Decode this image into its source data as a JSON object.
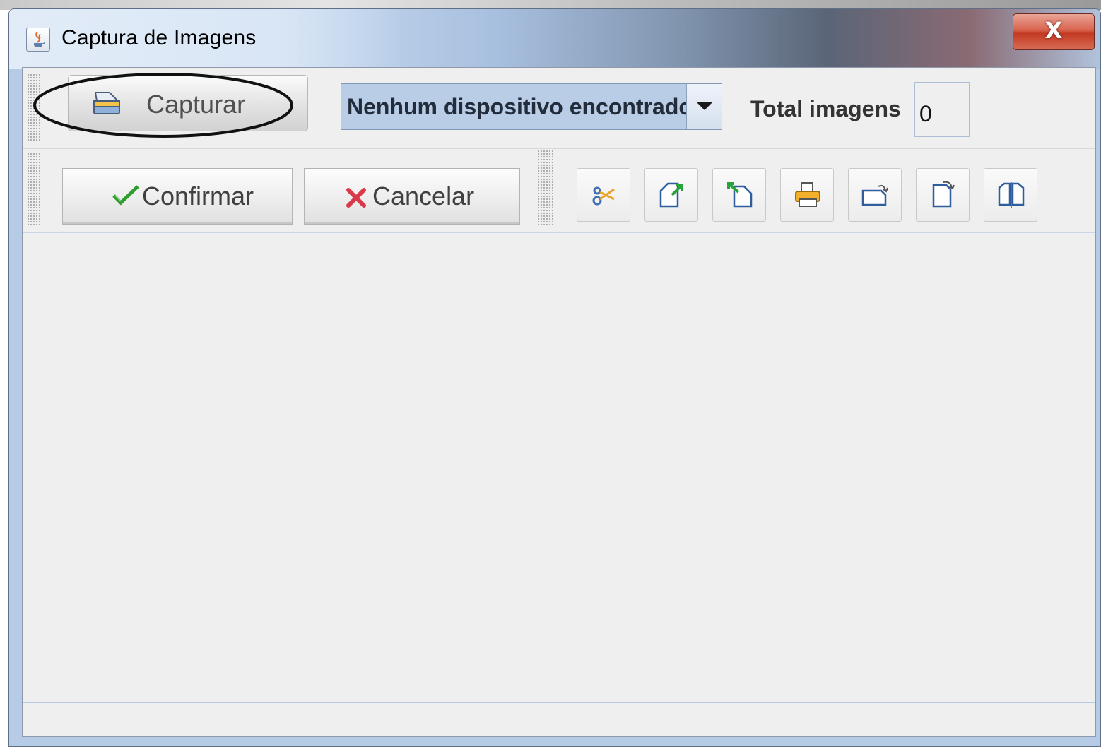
{
  "window": {
    "title": "Captura de Imagens",
    "close_label": "X",
    "app_icon": "java-cup-icon"
  },
  "toolbar": {
    "capture_label": "Capturar",
    "capture_icon": "scanner-icon",
    "device_select": {
      "selected": "Nenhum dispositivo encontrado"
    },
    "total_label": "Total imagens",
    "total_value": "0"
  },
  "actions": {
    "confirm_label": "Confirmar",
    "cancel_label": "Cancelar",
    "tools": [
      {
        "name": "cut-icon"
      },
      {
        "name": "export-icon"
      },
      {
        "name": "import-icon"
      },
      {
        "name": "print-icon"
      },
      {
        "name": "rotate-landscape-icon"
      },
      {
        "name": "rotate-portrait-icon"
      },
      {
        "name": "split-pages-icon"
      }
    ]
  },
  "colors": {
    "confirm_check": "#2e9d2e",
    "cancel_x": "#d93a4a",
    "combo_bg": "#b9cde6",
    "close_button": "#c9412a"
  }
}
